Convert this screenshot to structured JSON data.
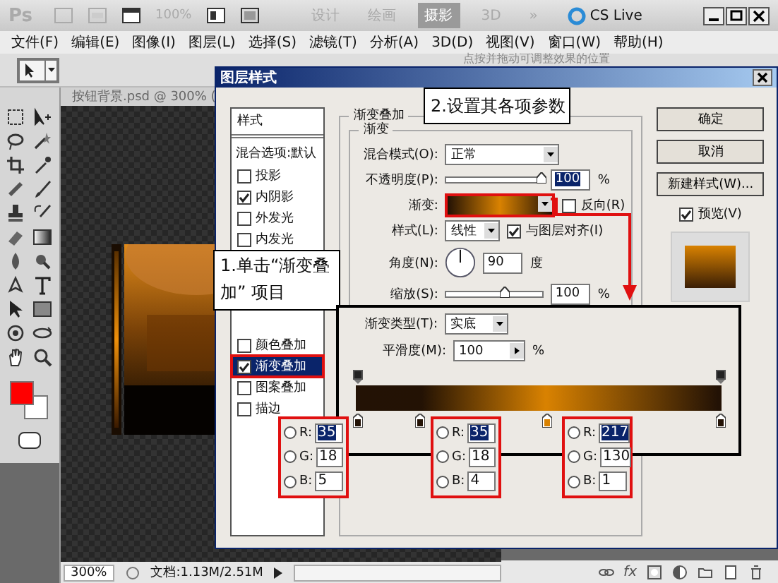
{
  "app_bar": {
    "logo": "Ps",
    "zoom": "100%",
    "workspaces": [
      {
        "label": "设计",
        "selected": false
      },
      {
        "label": "绘画",
        "selected": false
      },
      {
        "label": "摄影",
        "selected": true
      },
      {
        "label": "3D",
        "selected": false
      }
    ],
    "more": "»",
    "cs_live": "CS Live"
  },
  "menu": [
    "文件(F)",
    "编辑(E)",
    "图像(I)",
    "图层(L)",
    "选择(S)",
    "滤镜(T)",
    "分析(A)",
    "3D(D)",
    "视图(V)",
    "窗口(W)",
    "帮助(H)"
  ],
  "options_bar": {
    "hint": "点按并拖动可调整效果的位置"
  },
  "document": {
    "tab": "按钮背景.psd @ 300% (",
    "zoom": "300%",
    "doc_size": "文档:1.13M/2.51M"
  },
  "layers_panel": {
    "fx": "fx"
  },
  "dialog": {
    "title": "图层样式",
    "styles_header": "样式",
    "blending": "混合选项:默认",
    "styles": [
      {
        "label": "投影",
        "checked": false,
        "selected": false
      },
      {
        "label": "内阴影",
        "checked": true,
        "selected": false
      },
      {
        "label": "外发光",
        "checked": false,
        "selected": false
      },
      {
        "label": "内发光",
        "checked": false,
        "selected": false
      },
      {
        "label": "颜色叠加",
        "checked": false,
        "selected": false
      },
      {
        "label": "渐变叠加",
        "checked": true,
        "selected": true
      },
      {
        "label": "图案叠加",
        "checked": false,
        "selected": false
      },
      {
        "label": "描边",
        "checked": false,
        "selected": false
      }
    ],
    "section_title": "渐变叠加",
    "group_title": "渐变",
    "blend_mode": {
      "label": "混合模式(O):",
      "value": "正常"
    },
    "opacity": {
      "label": "不透明度(P):",
      "level": 0.98,
      "value": "100",
      "unit": "%"
    },
    "gradient": {
      "label": "渐变:",
      "reverse": {
        "label": "反向(R)",
        "checked": false
      }
    },
    "style": {
      "label": "样式(L):",
      "value": "线性",
      "align": {
        "label": "与图层对齐(I)",
        "checked": true
      }
    },
    "angle": {
      "label": "角度(N):",
      "value": "90",
      "unit": "度"
    },
    "scale": {
      "label": "缩放(S):",
      "level": 0.6,
      "value": "100",
      "unit": "%"
    },
    "buttons": [
      "确定",
      "取消",
      "新建样式(W)..."
    ],
    "preview": {
      "label": "预览(V)",
      "checked": true
    }
  },
  "gradient_editor": {
    "type": {
      "label": "渐变类型(T):",
      "value": "实底"
    },
    "smoothness": {
      "label": "平滑度(M):",
      "value": "100",
      "unit": "%"
    },
    "stops": [
      {
        "color": "#231205"
      },
      {
        "color": "#231204"
      },
      {
        "color": "#d98201"
      },
      {
        "color": "#231205"
      }
    ],
    "rgb": [
      {
        "channels": [
          {
            "label": "R:",
            "value": "35",
            "selected": true,
            "checked": false
          },
          {
            "label": "G:",
            "value": "18",
            "selected": false,
            "checked": false
          },
          {
            "label": "B:",
            "value": "5",
            "selected": false,
            "checked": false
          }
        ]
      },
      {
        "channels": [
          {
            "label": "R:",
            "value": "35",
            "selected": true,
            "checked": false
          },
          {
            "label": "G:",
            "value": "18",
            "selected": false,
            "checked": false
          },
          {
            "label": "B:",
            "value": "4",
            "selected": false,
            "checked": false
          }
        ]
      },
      {
        "channels": [
          {
            "label": "R:",
            "value": "217",
            "selected": true,
            "checked": false
          },
          {
            "label": "G:",
            "value": "130",
            "selected": false,
            "checked": false
          },
          {
            "label": "B:",
            "value": "1",
            "selected": false,
            "checked": false
          }
        ]
      }
    ]
  },
  "callouts": [
    "1.单击“渐变叠加” 项目",
    "2.设置其各项参数"
  ]
}
